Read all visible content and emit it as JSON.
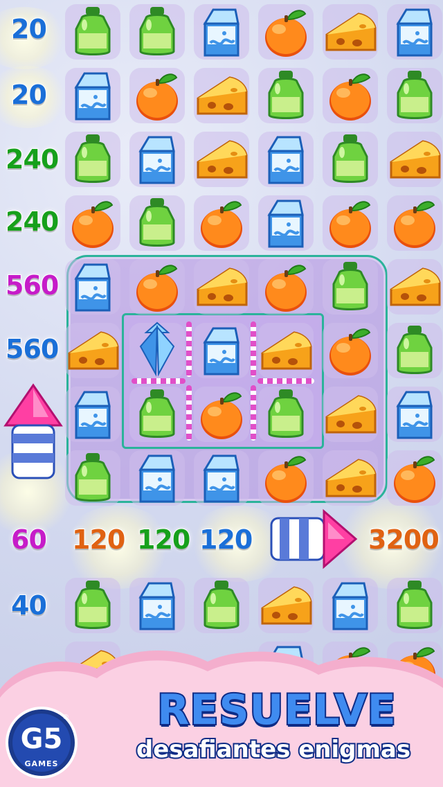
{
  "board": {
    "cols": 6,
    "rows": [
      [
        "bottle",
        "bottle",
        "milk",
        "orange",
        "cheese",
        "milk"
      ],
      [
        "milk",
        "orange",
        "cheese",
        "bottle",
        "orange",
        "bottle"
      ],
      [
        "bottle",
        "milk",
        "cheese",
        "milk",
        "bottle",
        "cheese"
      ],
      [
        "orange",
        "bottle",
        "orange",
        "milk",
        "orange",
        "orange"
      ],
      [
        "milk",
        "orange",
        "cheese",
        "orange",
        "bottle",
        "cheese"
      ],
      [
        "cheese",
        "rocket-vertical",
        "milk",
        "cheese",
        "orange",
        "bottle"
      ],
      [
        "milk",
        "bottle",
        "orange",
        "bottle",
        "cheese",
        "milk"
      ],
      [
        "bottle",
        "milk",
        "milk",
        "orange",
        "cheese",
        "orange"
      ],
      [
        "",
        "",
        "",
        "",
        "",
        ""
      ],
      [
        "bottle",
        "milk",
        "bottle",
        "cheese",
        "milk",
        "bottle"
      ],
      [
        "cheese",
        "",
        "",
        "milk",
        "orange",
        "orange"
      ]
    ]
  },
  "scores": {
    "left": [
      {
        "text": "20",
        "color": "blue"
      },
      {
        "text": "20",
        "color": "blue"
      },
      {
        "text": "240",
        "color": "green"
      },
      {
        "text": "240",
        "color": "green"
      },
      {
        "text": "560",
        "color": "magenta"
      },
      {
        "text": "560",
        "color": "blue"
      },
      {
        "text": "60",
        "color": "magenta"
      },
      {
        "text": "40",
        "color": "blue"
      }
    ],
    "row_bonus": [
      {
        "text": "120",
        "color": "orange"
      },
      {
        "text": "120",
        "color": "green"
      },
      {
        "text": "120",
        "color": "blue"
      },
      {
        "text": "3200",
        "color": "orange"
      }
    ]
  },
  "boosters": {
    "left_rocket": "firework-rocket-up",
    "right_rocket": "firework-rocket-right"
  },
  "banner": {
    "headline": "RESUELVE",
    "subline": "desafiantes enigmas",
    "logo_mark": "G5",
    "logo_sub": "GAMES",
    "logo_reg": "®"
  },
  "colors": {
    "score_blue": "#1a6fd8",
    "score_green": "#16a01b",
    "score_magenta": "#c61cc9",
    "score_orange": "#e06212",
    "frame": "#2bb39a",
    "banner_pink": "#f7bfd9",
    "headline_fill": "#3f8bf0",
    "headline_stroke": "#0d2c86"
  }
}
